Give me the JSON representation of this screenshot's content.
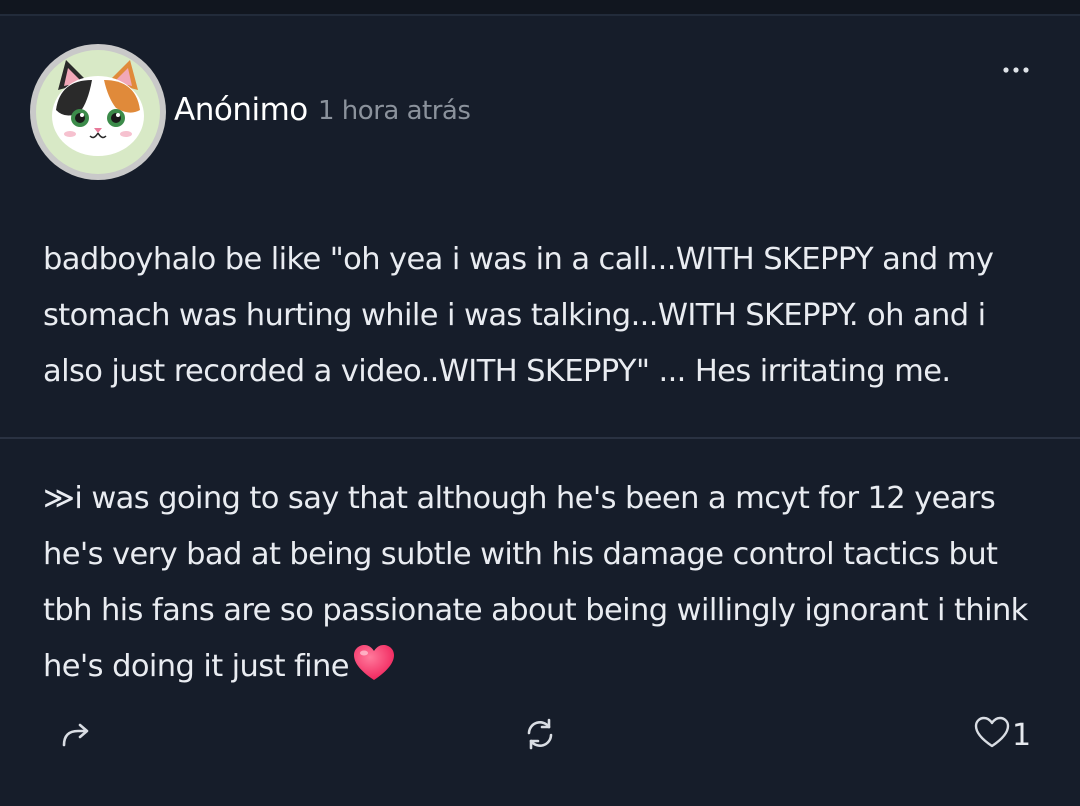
{
  "post": {
    "author": "Anónimo",
    "time": "1 hora atrás",
    "text": "badboyhalo be like \"oh yea i was in a call...WITH SKEPPY and my\nstomach was hurting while i was talking...WITH SKEPPY. oh and i\nalso just recorded a video..WITH SKEPPY\" ... Hes irritating me."
  },
  "reply": {
    "marker": "≫",
    "text": "i was going to say that although he's been a mcyt for 12 years he's very bad at being subtle with his damage control tactics but tbh his fans are so passionate about being willingly ignorant i think he's doing it just fine"
  },
  "actions": {
    "like_count": "1"
  },
  "icons": {
    "more": "more-options-icon",
    "share": "share-icon",
    "repost": "repost-icon",
    "like": "heart-outline-icon",
    "emoji": "heart-emoji-icon"
  },
  "colors": {
    "background": "#161d2a",
    "text": "#e9ecf1",
    "muted": "#8b929c",
    "heart": "#ff3d6e"
  }
}
